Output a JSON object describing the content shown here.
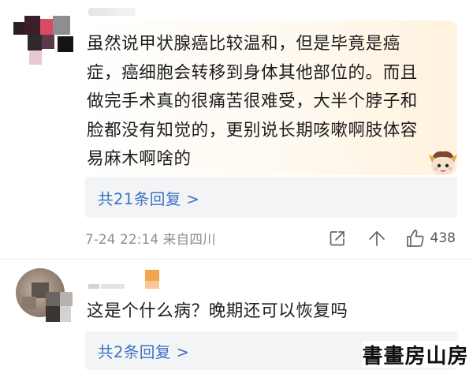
{
  "comment1": {
    "text": "虽然说甲状腺癌比较温和，但是毕竟是癌症，癌细胞会转移到身体其他部位的。而且做完手术真的很痛苦很难受，大半个脖子和脸都没有知觉的，更别说长期咳嗽啊肢体容易麻木啊啥的",
    "replies_label": "共21条回复 >",
    "time_location": "7-24 22:14 来自四川",
    "like_count": "438",
    "icons": [
      "share-icon",
      "comment-icon",
      "like-icon"
    ]
  },
  "comment2": {
    "text": "这是个什么病？晚期还可以恢复吗",
    "replies_label": "共2条回复 >"
  },
  "watermark": {
    "text": "書畫房山房"
  },
  "colors": {
    "link_blue": "#3b72c4",
    "meta_gray": "#8c8c8c",
    "reply_bg": "#f3f4f6",
    "bubble_tint": "#fff2de"
  }
}
